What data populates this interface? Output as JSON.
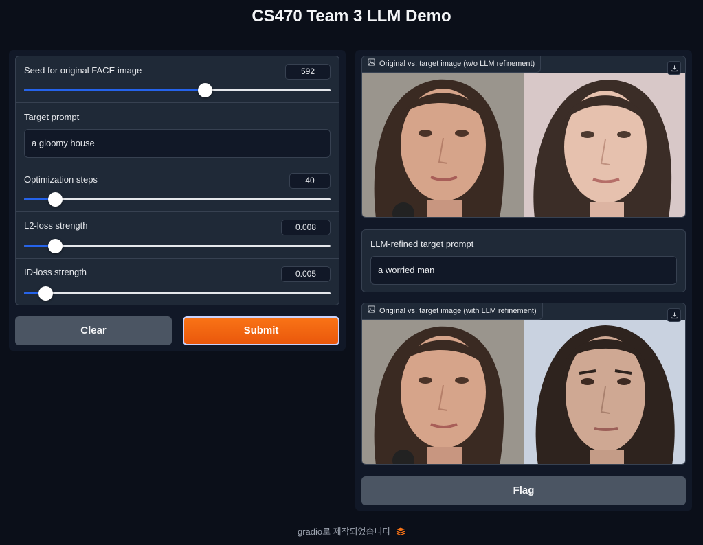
{
  "app": {
    "title": "CS470 Team 3 LLM Demo"
  },
  "inputs": {
    "seed": {
      "label": "Seed for original FACE image",
      "value": "592",
      "fraction": 0.59
    },
    "target_prompt": {
      "label": "Target prompt",
      "value": "a gloomy house"
    },
    "steps": {
      "label": "Optimization steps",
      "value": "40",
      "fraction": 0.1
    },
    "l2": {
      "label": "L2-loss strength",
      "value": "0.008",
      "fraction": 0.1
    },
    "id": {
      "label": "ID-loss strength",
      "value": "0.005",
      "fraction": 0.07
    }
  },
  "buttons": {
    "clear": "Clear",
    "submit": "Submit",
    "flag": "Flag"
  },
  "outputs": {
    "image1": {
      "label": "Original vs. target image (w/o LLM refinement)"
    },
    "llm_prompt": {
      "label": "LLM-refined target prompt",
      "value": "a worried man"
    },
    "image2": {
      "label": "Original vs. target image (with LLM refinement)"
    }
  },
  "footer": {
    "text": "gradio로 제작되었습니다"
  },
  "colors": {
    "accent": "#2563eb",
    "submit": "#f97316",
    "background": "#0b0f19",
    "panel": "#1f2937"
  },
  "icons": [
    "image-icon",
    "download-icon",
    "gradio-logo-icon"
  ]
}
